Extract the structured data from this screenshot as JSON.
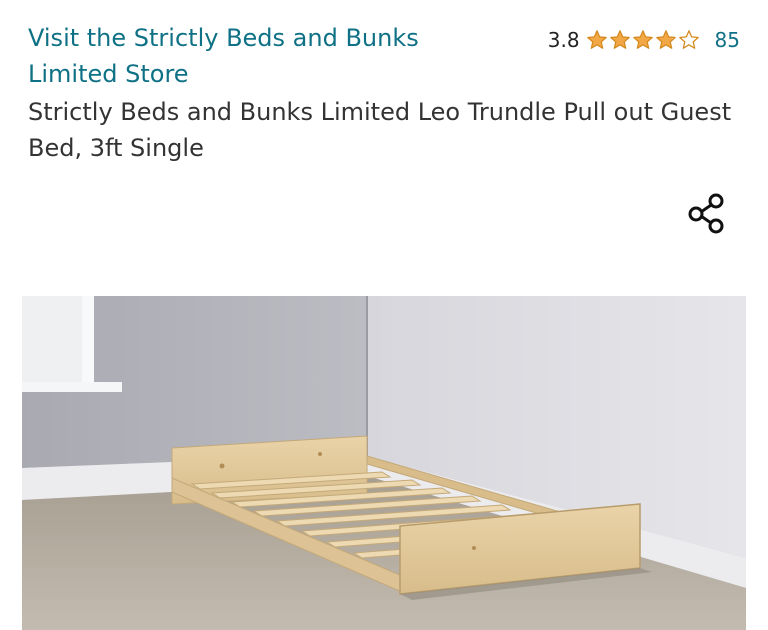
{
  "header": {
    "store_link": "Visit the Strictly Beds and Bunks Limited Store",
    "rating_value": "3.8",
    "rating_stars": 3.8,
    "rating_max": 5,
    "rating_count": "85",
    "star_color": "#f3a847"
  },
  "product": {
    "title": "Strictly Beds and Bunks Limited Leo Trundle Pull out Guest Bed, 3ft Single"
  },
  "icons": {
    "share": "share-icon",
    "star": "star-icon"
  },
  "colors": {
    "link": "#0f7185",
    "text": "#333333"
  }
}
